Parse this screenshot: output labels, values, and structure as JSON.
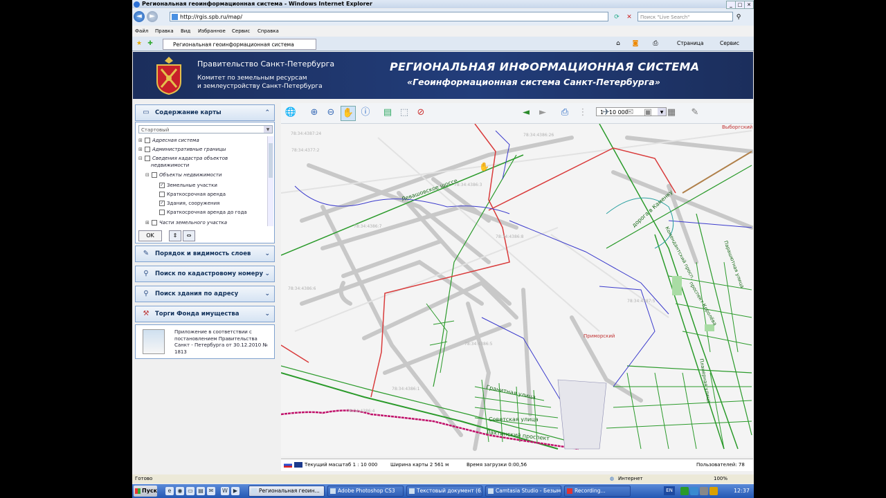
{
  "window": {
    "title": "Региональная геоинформационная система - Windows Internet Explorer"
  },
  "address": {
    "url": "http://rgis.spb.ru/map/",
    "search_placeholder": "Поиск \"Live Search\""
  },
  "menu": [
    "Файл",
    "Правка",
    "Вид",
    "Избранное",
    "Сервис",
    "Справка"
  ],
  "tab": {
    "label": "Региональная геоинформационная система"
  },
  "toolbar_right": {
    "page": "Страница",
    "tools": "Сервис"
  },
  "banner": {
    "left_title": "Правительство Санкт-Петербурга",
    "left_sub1": "Комитет по земельным ресурсам",
    "left_sub2": "и землеустройству Санкт-Петербурга",
    "right_title": "РЕГИОНАЛЬНАЯ ИНФОРМАЦИОННАЯ СИСТЕМА",
    "right_sub": "«Геоинформационная система Санкт-Петербурга»"
  },
  "panel": {
    "content_header": "Содержание карты",
    "select_value": "Стартовый",
    "tree": [
      {
        "label": "Адресная система",
        "checked": false
      },
      {
        "label": "Административные границы",
        "checked": false
      },
      {
        "label": "Сведения кадастра объектов",
        "checked": false
      },
      {
        "label": "недвижимости",
        "checked": false
      },
      {
        "label": "Объекты недвижимости",
        "checked": false
      },
      {
        "label": "Земельные участки",
        "checked": true
      },
      {
        "label": "Краткосрочная аренда",
        "checked": false
      },
      {
        "label": "Здания, сооружения",
        "checked": true
      },
      {
        "label": "Краткосрочная аренда до года",
        "checked": false
      },
      {
        "label": "Части земельного участка",
        "checked": false
      }
    ],
    "ok_label": "OK",
    "layers_header": "Порядок и видимость слоев",
    "cadastre_header": "Поиск по кадастровому номеру",
    "address_header": "Поиск здания по адресу",
    "trade_header": "Торги Фонда имущества",
    "doc_text": "Приложение в соответствии с постановлением Правительства Санкт - Петербурга от 30.12.2010 № 1813"
  },
  "map_toolbar": {
    "scale": "1 : 10 000"
  },
  "map_labels": {
    "vyborgsky": "Выборгский",
    "primorsky": "Приморский",
    "road1": "Левашовское шоссе",
    "road2": "дорога в Каменку",
    "road3": "Комендантский просп.",
    "road4": "Гранитная улица",
    "road5": "Советская улица",
    "road6": "Лахтинский проспект",
    "road7": "Планерная улица",
    "road8": "проспект Королёва",
    "road9": "Парашютная улица",
    "cad": [
      "78:34:4387:24",
      "78:34:4386:26",
      "78:34:4386:7",
      "78:34:4386:8",
      "78:34:4386:3",
      "78:34:4386:6",
      "78:34:4386:5",
      "78:34:4386:1",
      "78:34:4387:5",
      "78:34:4377:2",
      "78:34:4386:4"
    ]
  },
  "map_status": {
    "scale": "Текущий масштаб 1 : 10 000",
    "width": "Ширина карты 2 561 м",
    "load": "Время загрузки 0:00,56",
    "users": "Пользователей: 78"
  },
  "ie_status": {
    "ready": "Готово",
    "zone": "Интернет",
    "zoom": "100%"
  },
  "taskbar": {
    "start": "Пуск",
    "tasks": [
      "Региональная геоин...",
      "Adobe Photoshop CS3",
      "Текстовый документ (6...",
      "Camtasia Studio - Безым...",
      "Recording..."
    ],
    "lang": "EN",
    "clock": "12:37"
  }
}
